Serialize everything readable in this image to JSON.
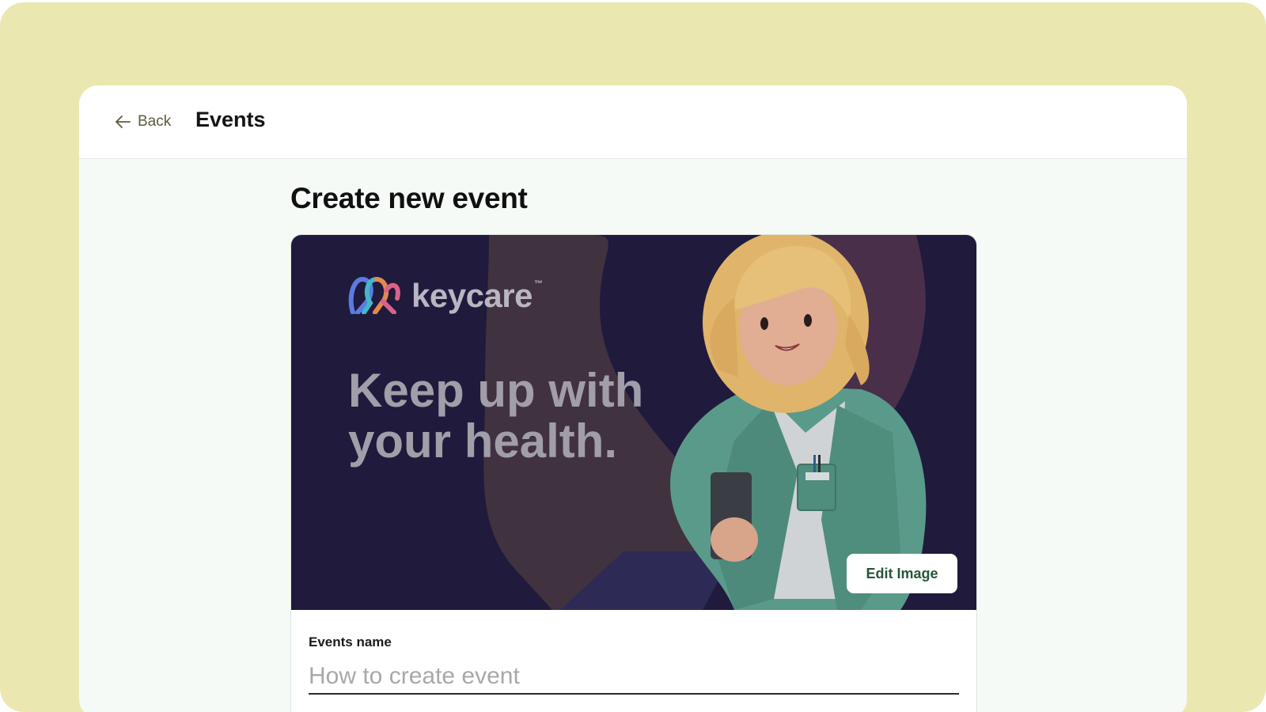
{
  "header": {
    "back_label": "Back",
    "title": "Events"
  },
  "page": {
    "title": "Create new event"
  },
  "banner": {
    "logo_text": "keycare",
    "logo_tm": "™",
    "headline_line1": "Keep up with",
    "headline_line2": "your health.",
    "edit_button_label": "Edit Image"
  },
  "form": {
    "event_name_label": "Events name",
    "event_name_placeholder": "How to create event",
    "event_name_value": ""
  },
  "colors": {
    "outer_background": "#eae8b0",
    "content_background": "#f5faf6",
    "banner_background": "#201a3c",
    "accent_text": "#27553c",
    "back_text": "#5f5b3a"
  },
  "icons": {
    "back": "arrow-left-icon",
    "logo": "keycare-logo-icon"
  }
}
